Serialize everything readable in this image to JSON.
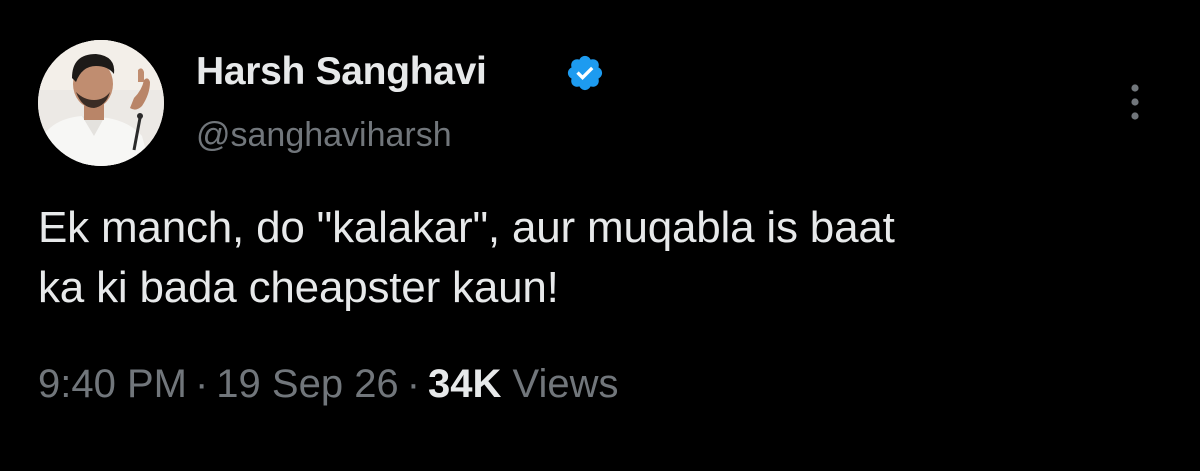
{
  "author": {
    "display_name": "Harsh Sanghavi",
    "handle": "@sanghaviharsh",
    "verified": true,
    "verified_color": "#1d9bf0"
  },
  "tweet": {
    "line1": "Ek manch, do \"kalakar\", aur muqabla is baat",
    "line2": "ka ki bada cheapster kaun!"
  },
  "meta": {
    "time": "9:40 PM",
    "separator": "·",
    "date": "19 Sep 26",
    "views_count": "34K",
    "views_label": "Views"
  },
  "icons": {
    "verified": "verified-badge-icon",
    "more": "more-options-icon"
  }
}
